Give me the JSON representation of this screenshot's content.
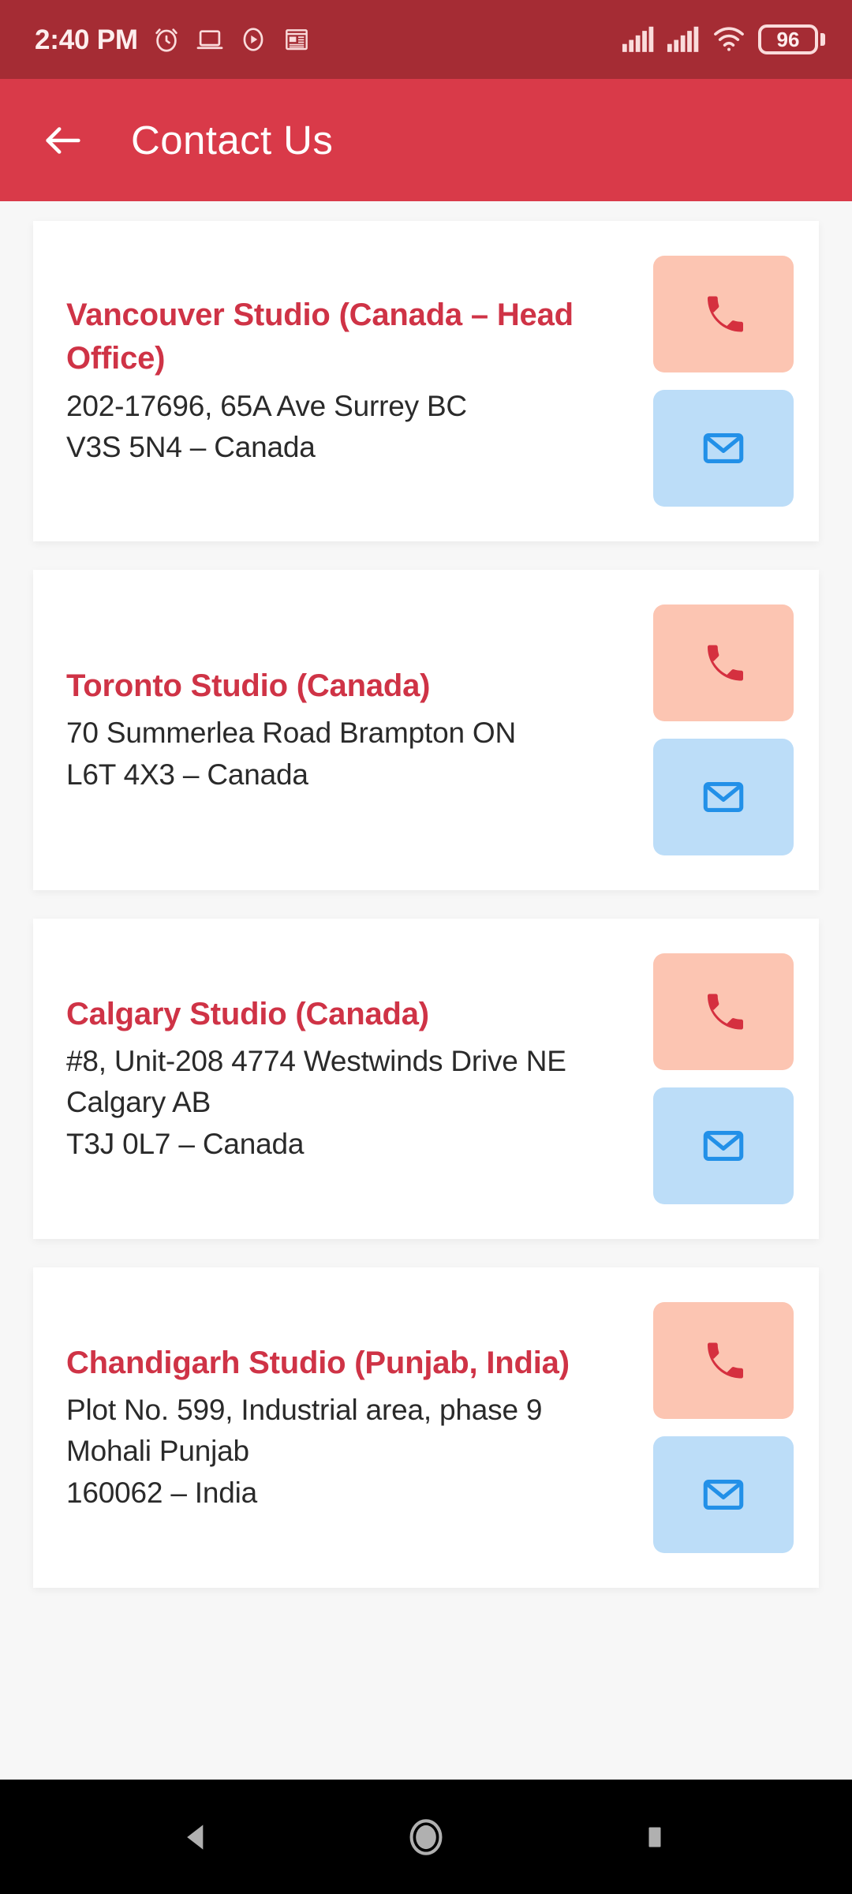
{
  "status_bar": {
    "time": "2:40 PM",
    "battery_percent": "96",
    "icons": [
      "alarm-clock-icon",
      "screencast-icon",
      "play-circle-icon",
      "news-icon",
      "signal-bars-sim1-icon",
      "signal-bars-sim2-icon",
      "wifi-icon",
      "battery-icon"
    ],
    "bg_color": "#a52c34",
    "fg_color": "#fdeeee"
  },
  "app_bar": {
    "title": "Contact Us",
    "back_icon": "arrow-left-icon",
    "bg_color": "#d93a49",
    "title_color": "#ffffff"
  },
  "theme": {
    "page_bg": "#f7f7f7",
    "card_bg": "#ffffff",
    "accent_red": "#cf3346",
    "call_button_bg": "#fcc5b2",
    "call_icon_color": "#d5303f",
    "mail_button_bg": "#bcddf8",
    "mail_icon_color": "#2290e8",
    "address_color": "#2a2a2a"
  },
  "contacts": [
    {
      "title": "Vancouver Studio (Canada – Head Office)",
      "address_lines": [
        "202-17696, 65A Ave Surrey BC",
        "V3S 5N4 – Canada"
      ],
      "call_label": "call-icon",
      "mail_label": "mail-icon"
    },
    {
      "title": "Toronto Studio (Canada)",
      "address_lines": [
        "70 Summerlea Road Brampton ON",
        "L6T 4X3 – Canada"
      ],
      "call_label": "call-icon",
      "mail_label": "mail-icon"
    },
    {
      "title": "Calgary Studio (Canada)",
      "address_lines": [
        "#8, Unit-208 4774 Westwinds Drive NE",
        "Calgary AB",
        "T3J 0L7 – Canada"
      ],
      "call_label": "call-icon",
      "mail_label": "mail-icon"
    },
    {
      "title": "Chandigarh Studio (Punjab, India)",
      "address_lines": [
        "Plot No. 599, Industrial area, phase 9",
        "Mohali Punjab",
        "160062 – India"
      ],
      "call_label": "call-icon",
      "mail_label": "mail-icon"
    }
  ],
  "nav_bar": {
    "back": "triangle-back-icon",
    "home": "circle-home-icon",
    "recents": "square-recents-icon",
    "bg_color": "#000000",
    "icon_color": "#b0b0b0"
  }
}
